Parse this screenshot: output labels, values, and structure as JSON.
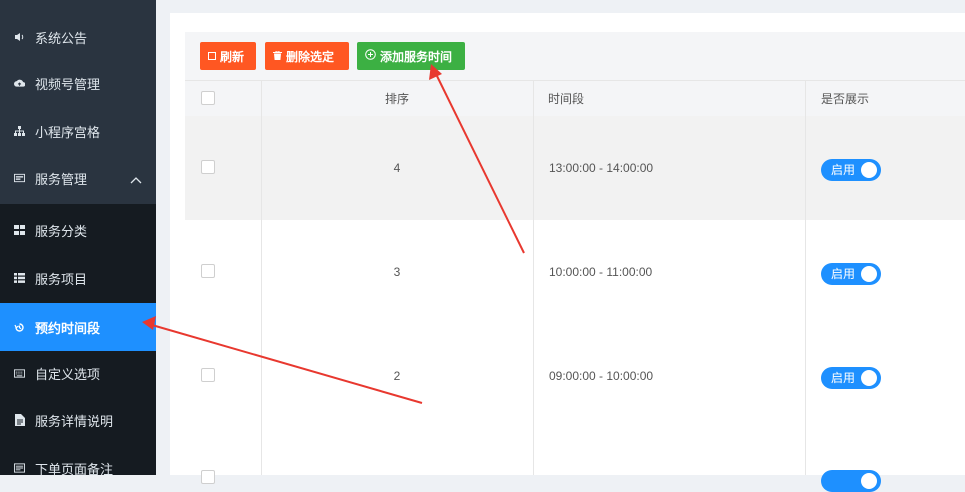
{
  "sidebar": {
    "items": [
      {
        "label": "系统公告",
        "icon": "speaker-icon"
      },
      {
        "label": "视频号管理",
        "icon": "cloud-upload-icon"
      },
      {
        "label": "小程序宫格",
        "icon": "sitemap-icon"
      },
      {
        "label": "服务管理",
        "icon": "card-icon"
      }
    ],
    "sub_items": [
      {
        "label": "服务分类",
        "icon": "grid-icon"
      },
      {
        "label": "服务项目",
        "icon": "list-icon"
      },
      {
        "label": "预约时间段",
        "icon": "history-icon"
      },
      {
        "label": "自定义选项",
        "icon": "keyboard-icon"
      },
      {
        "label": "服务详情说明",
        "icon": "file-icon"
      },
      {
        "label": "下单页面备注",
        "icon": "note-icon"
      }
    ],
    "active": "预约时间段"
  },
  "toolbar": {
    "refresh_label": "刷新",
    "delete_label": "删除选定",
    "add_label": "添加服务时间"
  },
  "table": {
    "headers": [
      "排序",
      "时间段",
      "是否展示"
    ],
    "rows": [
      {
        "order": "4",
        "time": "13:00:00 - 14:00:00",
        "status": "启用"
      },
      {
        "order": "3",
        "time": "10:00:00 - 11:00:00",
        "status": "启用"
      },
      {
        "order": "2",
        "time": "09:00:00 - 10:00:00",
        "status": "启用"
      },
      {
        "order": "",
        "time": "",
        "status": ""
      }
    ]
  },
  "colors": {
    "sidebar_bg": "#2a3440",
    "active": "#1e90ff",
    "danger": "#ff5722",
    "success": "#3cb043",
    "annotation": "#e8382f"
  }
}
